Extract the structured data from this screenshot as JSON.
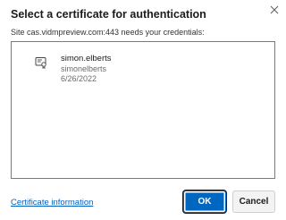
{
  "dialog": {
    "title": "Select a certificate for authentication",
    "subtitle": "Site cas.vidmpreview.com:443 needs your credentials:",
    "close_icon": "close-icon"
  },
  "certificates": [
    {
      "icon": "certificate-icon",
      "name": "simon.elberts",
      "issuer": "simonelberts",
      "date": "6/26/2022"
    }
  ],
  "footer": {
    "info_link": "Certificate information",
    "ok_label": "OK",
    "cancel_label": "Cancel"
  },
  "colors": {
    "accent": "#0067c0",
    "link": "#0060c0"
  }
}
